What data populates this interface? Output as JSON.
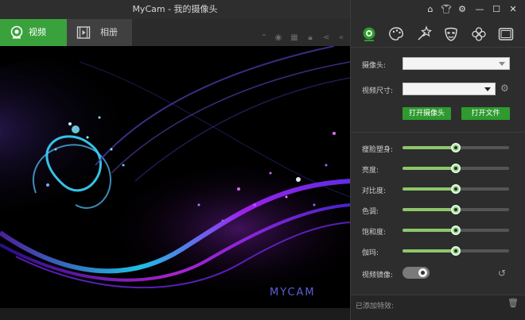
{
  "window": {
    "title": "MyCam - 我的摄像头"
  },
  "tabs": [
    {
      "label": "视频",
      "icon": "webcam-icon",
      "active": true
    },
    {
      "label": "相册",
      "icon": "film-icon",
      "active": false
    }
  ],
  "toolbar_icons": [
    "up-arrow-icon",
    "broadcast-icon",
    "qr-code-icon",
    "lock-icon",
    "share-icon",
    "collapse-icon"
  ],
  "window_controls": [
    "home-icon",
    "shirt-icon",
    "gear-icon",
    "minimize-icon",
    "maximize-icon",
    "close-icon"
  ],
  "effect_icons": [
    "webcam-icon",
    "palette-icon",
    "magic-wand-icon",
    "mask-icon",
    "clover-icon",
    "frame-icon"
  ],
  "camera": {
    "label": "摄像头:",
    "value": ""
  },
  "video_size": {
    "label": "视频尺寸:",
    "value": ""
  },
  "buttons": {
    "open_camera": "打开摄像头",
    "open_file": "打开文件"
  },
  "sliders": [
    {
      "label": "瘦脸塑身:",
      "value": 0.5
    },
    {
      "label": "亮度:",
      "value": 0.5
    },
    {
      "label": "对比度:",
      "value": 0.5
    },
    {
      "label": "色调:",
      "value": 0.5
    },
    {
      "label": "饱和度:",
      "value": 0.5
    },
    {
      "label": "伽玛:",
      "value": 0.5
    }
  ],
  "mirror": {
    "label": "视频镜像:",
    "on": true
  },
  "footer": {
    "label": "已添加特效:"
  },
  "watermark": "MYCAM",
  "colors": {
    "accent": "#3aa23c",
    "slider_fill": "#8ec66a"
  }
}
